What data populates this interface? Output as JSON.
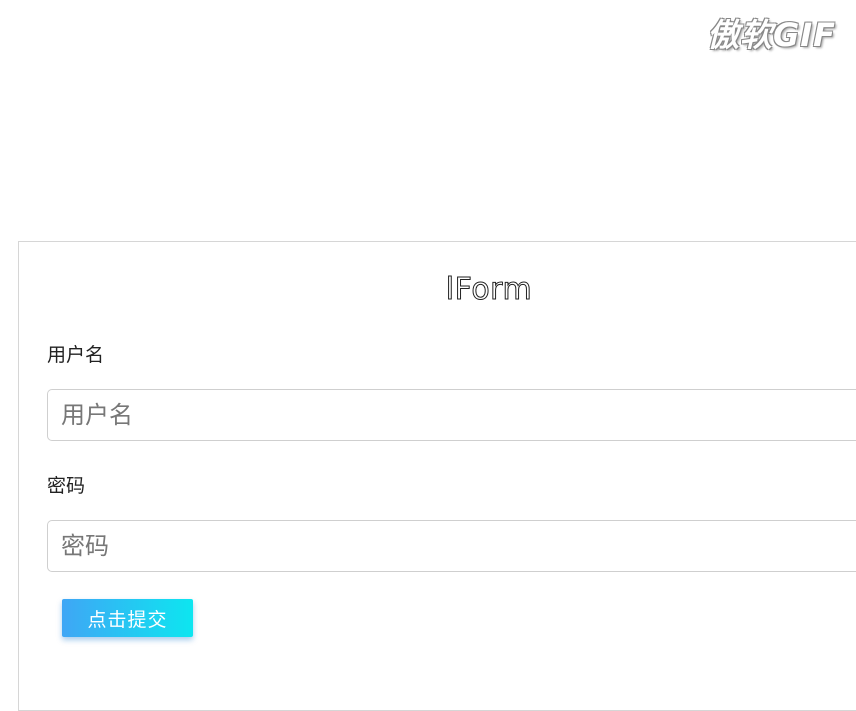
{
  "watermark": {
    "text": "傲软GIF"
  },
  "form": {
    "title": "lForm",
    "username": {
      "label": "用户名",
      "placeholder": "用户名",
      "value": ""
    },
    "password": {
      "label": "密码",
      "placeholder": "密码",
      "value": ""
    },
    "submit_label": "点击提交"
  },
  "colors": {
    "button_gradient_start": "#3fa6f5",
    "button_gradient_end": "#0de6f0",
    "border": "#cfcfcf"
  }
}
